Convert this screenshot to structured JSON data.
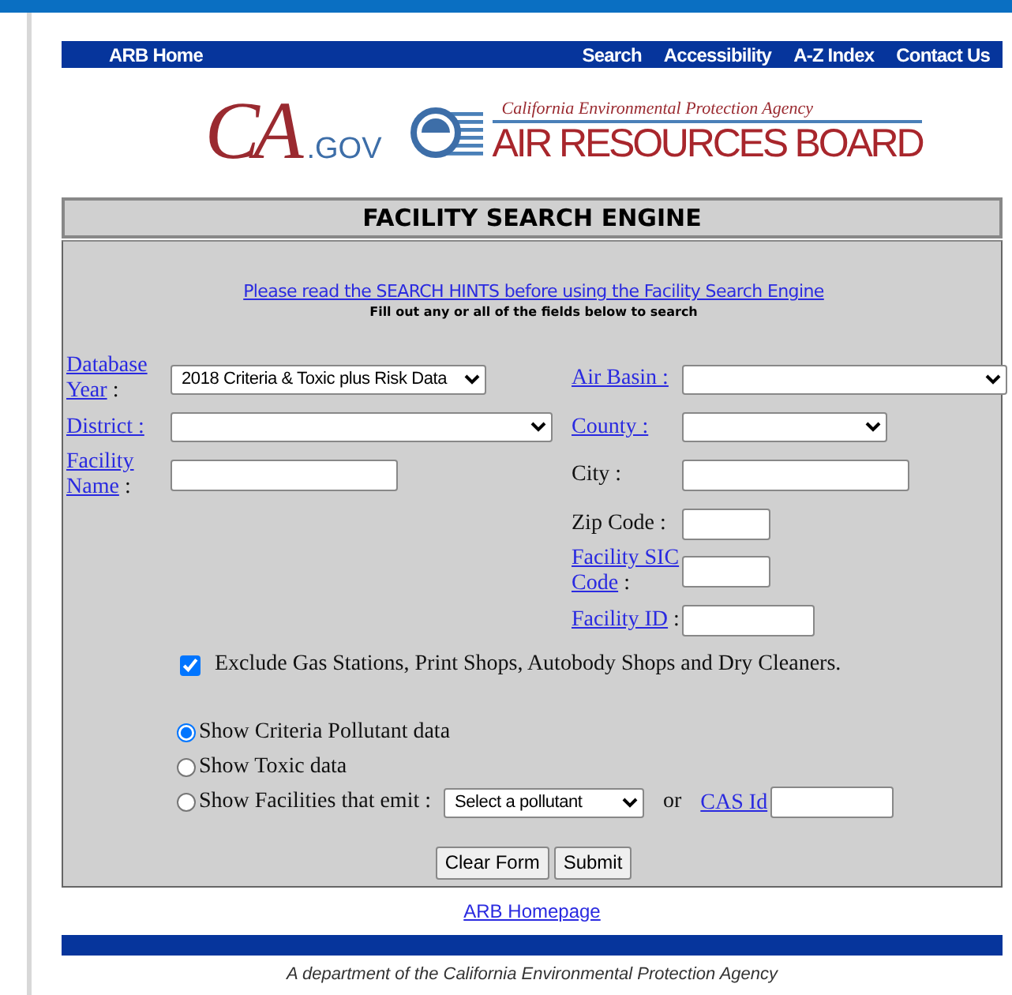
{
  "nav": {
    "home": "ARB Home",
    "links": [
      "Search",
      "Accessibility",
      "A-Z Index",
      "Contact Us"
    ]
  },
  "logo": {
    "ca": "CA",
    "gov": ".GOV",
    "agency": "California Environmental Protection Agency",
    "board": "AIR RESOURCES BOARD"
  },
  "title": "FACILITY SEARCH ENGINE",
  "hints_link": "Please read the SEARCH HINTS before using the Facility Search Engine",
  "instruction": "Fill out any or all of the fields below to search",
  "left_fields": [
    {
      "label": "Database Year",
      "suffix": " :",
      "link": true,
      "kind": "select",
      "value": "2018 Criteria & Toxic plus Risk Data"
    },
    {
      "label": "District :",
      "link": true,
      "kind": "select"
    },
    {
      "label": "Facility Name",
      "suffix": " :",
      "link": true,
      "kind": "input"
    }
  ],
  "right_fields": [
    {
      "label": "Air Basin :",
      "link": true,
      "kind": "select"
    },
    {
      "label": "County :",
      "link": true,
      "kind": "select"
    },
    {
      "label": "City :",
      "link": false,
      "kind": "input"
    },
    {
      "label": "Zip Code :",
      "link": false,
      "kind": "input"
    },
    {
      "label": "Facility SIC Code",
      "suffix": " :",
      "link": true,
      "kind": "input"
    },
    {
      "label": "Facility ID",
      "suffix": " :",
      "link": true,
      "kind": "input"
    }
  ],
  "exclude": {
    "label": "Exclude Gas Stations, Print Shops, Autobody Shops and Dry Cleaners.",
    "checked": true
  },
  "options": [
    {
      "label": "Show Criteria Pollutant data",
      "selected": true
    },
    {
      "label": "Show Toxic data",
      "selected": false
    },
    {
      "label": "Show Facilities that emit :",
      "selected": false,
      "pollutant": "Select a pollutant",
      "or": "or",
      "cas_link": "CAS Id"
    }
  ],
  "buttons": [
    "Clear Form",
    "Submit"
  ],
  "footer_link": "ARB Homepage",
  "footer_text": "A department of the California Environmental Protection Agency"
}
